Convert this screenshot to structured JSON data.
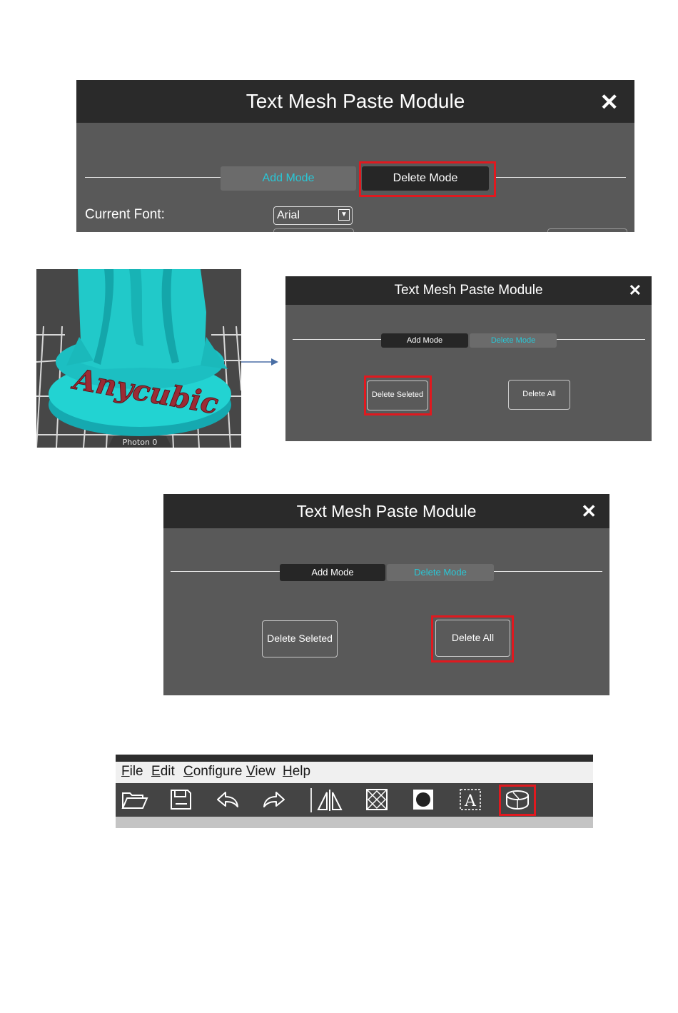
{
  "panel1": {
    "title": "Text Mesh Paste Module",
    "close": "✕",
    "tab_add": "Add Mode",
    "tab_delete": "Delete Mode",
    "font_label": "Current Font:",
    "font_value": "Arial"
  },
  "figure": {
    "model_text": "Anycubic",
    "plate_label": "Photon 0"
  },
  "panel2": {
    "title": "Text Mesh Paste Module",
    "close": "✕",
    "tab_add": "Add Mode",
    "tab_delete": "Delete Mode",
    "delete_selected": "Delete Seleted",
    "delete_all": "Delete All"
  },
  "panel3": {
    "title": "Text Mesh Paste Module",
    "close": "✕",
    "tab_add": "Add Mode",
    "tab_delete": "Delete Mode",
    "delete_selected": "Delete Seleted",
    "delete_all": "Delete All"
  },
  "toolbar": {
    "menu": [
      {
        "key": "F",
        "rest": "ile"
      },
      {
        "key": "E",
        "rest": "dit"
      },
      {
        "key": "C",
        "rest": "onfigure"
      },
      {
        "key": "V",
        "rest": "iew"
      },
      {
        "key": "H",
        "rest": "elp"
      }
    ],
    "icons": [
      "open-folder-icon",
      "save-icon",
      "undo-icon",
      "redo-icon",
      "mirror-icon",
      "hollow-icon",
      "fill-icon",
      "text-icon",
      "text-mesh-paste-icon"
    ]
  },
  "colors": {
    "highlight": "#e0191f",
    "accent_cyan": "#29c7d6",
    "title_bar": "#2a2a2a",
    "panel_body": "#595959"
  }
}
